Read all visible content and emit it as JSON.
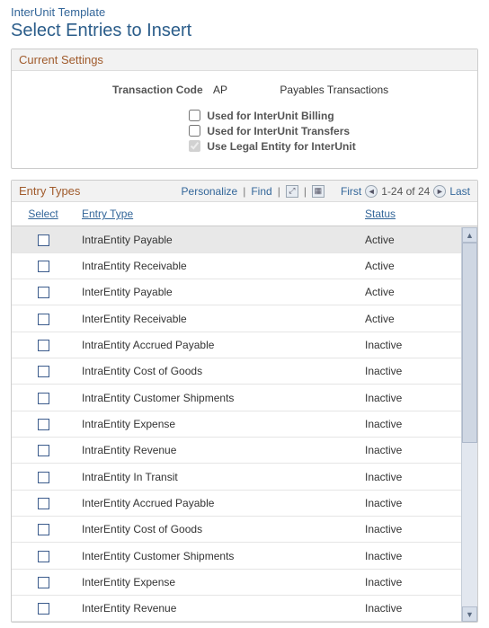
{
  "app_title": "InterUnit Template",
  "page_title": "Select Entries to Insert",
  "settings": {
    "header": "Current Settings",
    "tx_label": "Transaction Code",
    "tx_code": "AP",
    "tx_desc": "Payables Transactions",
    "checks": {
      "billing": {
        "label": "Used for InterUnit Billing",
        "checked": false
      },
      "transfers": {
        "label": "Used for InterUnit Transfers",
        "checked": false
      },
      "legal": {
        "label": "Use Legal Entity for InterUnit",
        "checked": true
      }
    }
  },
  "grid": {
    "header": "Entry Types",
    "tools": {
      "personalize": "Personalize",
      "find": "Find",
      "first": "First",
      "last": "Last",
      "range": "1-24 of 24"
    },
    "columns": {
      "select": "Select",
      "type": "Entry Type",
      "status": "Status"
    },
    "rows": [
      {
        "type": "IntraEntity Payable",
        "status": "Active"
      },
      {
        "type": "IntraEntity Receivable",
        "status": "Active"
      },
      {
        "type": "InterEntity Payable",
        "status": "Active"
      },
      {
        "type": "InterEntity Receivable",
        "status": "Active"
      },
      {
        "type": "IntraEntity Accrued Payable",
        "status": "Inactive"
      },
      {
        "type": "IntraEntity Cost of Goods",
        "status": "Inactive"
      },
      {
        "type": "IntraEntity Customer Shipments",
        "status": "Inactive"
      },
      {
        "type": "IntraEntity Expense",
        "status": "Inactive"
      },
      {
        "type": "IntraEntity Revenue",
        "status": "Inactive"
      },
      {
        "type": "IntraEntity In Transit",
        "status": "Inactive"
      },
      {
        "type": "InterEntity Accrued Payable",
        "status": "Inactive"
      },
      {
        "type": "InterEntity Cost of Goods",
        "status": "Inactive"
      },
      {
        "type": "InterEntity Customer Shipments",
        "status": "Inactive"
      },
      {
        "type": "InterEntity Expense",
        "status": "Inactive"
      },
      {
        "type": "InterEntity Revenue",
        "status": "Inactive"
      }
    ]
  }
}
